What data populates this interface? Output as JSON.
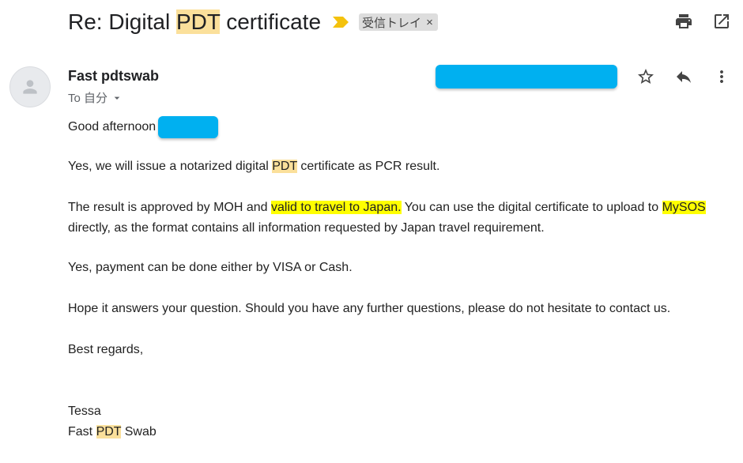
{
  "subject": {
    "prefix": "Re: Digital ",
    "highlight": "PDT",
    "suffix": " certificate",
    "label": "受信トレイ",
    "label_close": "×"
  },
  "sender": {
    "name": "Fast pdtswab",
    "to_label": "To 自分"
  },
  "body": {
    "greeting": "Good afternoon",
    "p1_before": "Yes, we will issue a notarized digital ",
    "p1_hl": "PDT",
    "p1_after": " certificate as PCR result.",
    "p2_before": "The result is approved by MOH and ",
    "p2_hl1": "valid to travel to Japan.",
    "p2_mid": " You can use the digital certificate to upload to ",
    "p2_hl2": "MySOS",
    "p2_after": " directly, as the format contains all information requested by Japan travel requirement.",
    "p3": "Yes, payment can be done either by VISA or Cash.",
    "p4": "Hope it answers your question. Should you have any further questions, please do not hesitate to contact us.",
    "p5": "Best regards,",
    "sig_name": "Tessa",
    "sig_company_before": "Fast ",
    "sig_company_hl": "PDT",
    "sig_company_after": " Swab"
  },
  "icons": {
    "print": "print-icon",
    "open_new_window": "open-in-new-window-icon",
    "star": "star-icon",
    "reply": "reply-icon",
    "more": "more-vert-icon",
    "importance": "importance-marker-icon",
    "avatar": "person-avatar-icon",
    "dropdown": "chevron-down-icon"
  },
  "colors": {
    "highlight_soft": "#fbe09b",
    "highlight_strong": "#ffff00",
    "redaction": "#00b0f0",
    "importance": "#f4c20d"
  }
}
